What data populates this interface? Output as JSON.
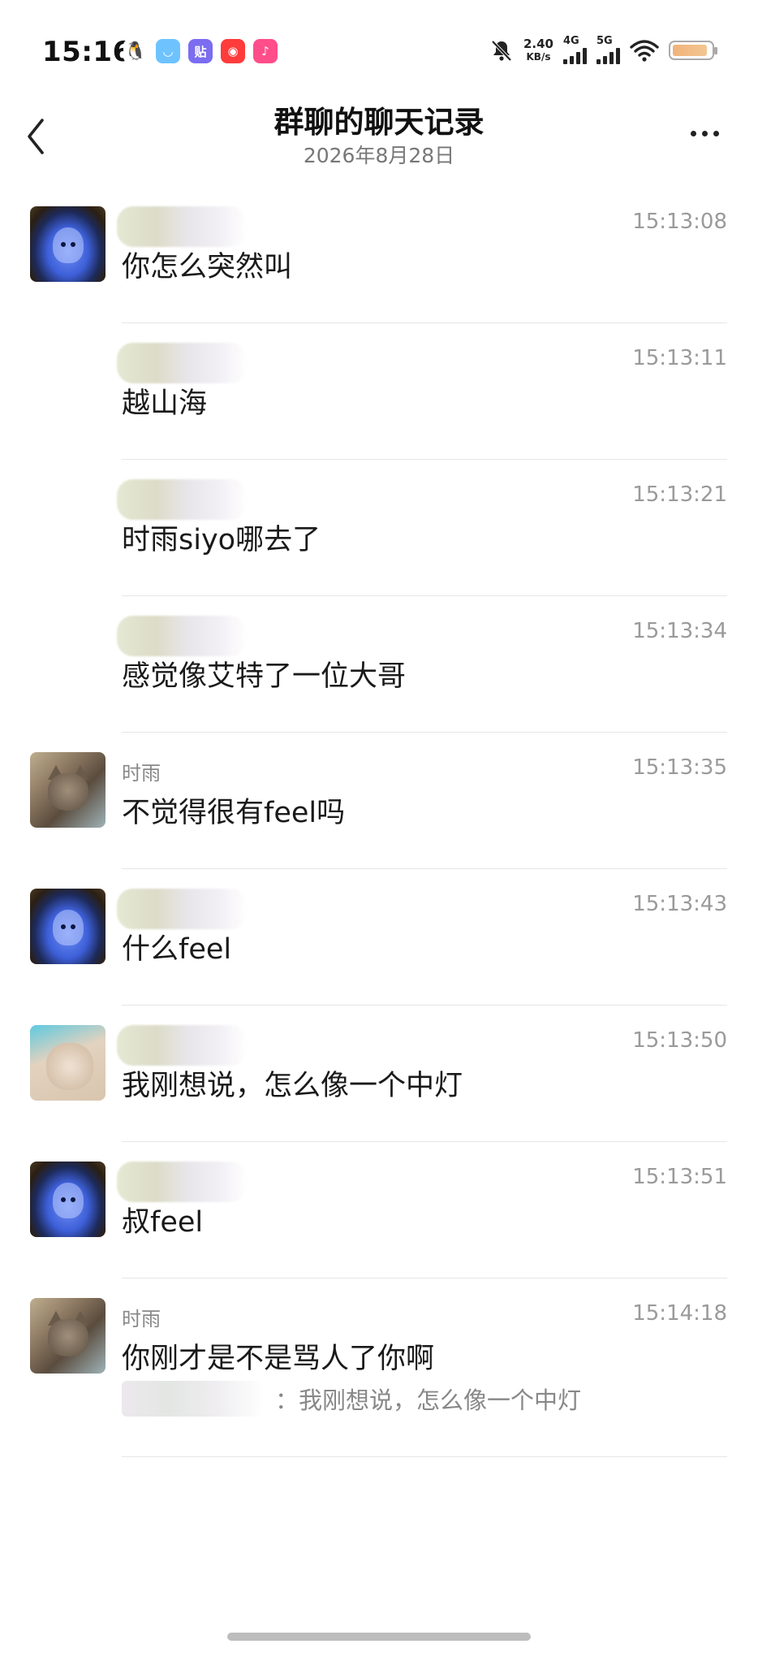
{
  "status_bar": {
    "time": "15:16",
    "app_icons": [
      "qq-icon",
      "chat-app-icon",
      "sticker-app-icon",
      "red-app-icon",
      "music-app-icon"
    ],
    "net_speed_value": "2.40",
    "net_speed_unit": "KB/s",
    "signal_1_label": "4G",
    "signal_2_label": "5G"
  },
  "header": {
    "title": "群聊的聊天记录",
    "subtitle": "2026年8月28日"
  },
  "messages": [
    {
      "sender": "",
      "time": "15:13:08",
      "text": "你怎么突然叫",
      "avatar": "ghost"
    },
    {
      "sender": "",
      "time": "15:13:11",
      "text": "越山海",
      "avatar": ""
    },
    {
      "sender": "",
      "time": "15:13:21",
      "text": "时雨siyo哪去了",
      "avatar": ""
    },
    {
      "sender": "",
      "time": "15:13:34",
      "text": "感觉像艾特了一位大哥",
      "avatar": ""
    },
    {
      "sender": "时雨",
      "time": "15:13:35",
      "text": "不觉得很有feel吗",
      "avatar": "cat"
    },
    {
      "sender": "",
      "time": "15:13:43",
      "text": "什么feel",
      "avatar": "ghost"
    },
    {
      "sender": "",
      "time": "15:13:50",
      "text": "我刚想说，怎么像一个中灯",
      "avatar": "cat2"
    },
    {
      "sender": "",
      "time": "15:13:51",
      "text": "叔feel",
      "avatar": "ghost"
    },
    {
      "sender": "时雨",
      "time": "15:14:18",
      "text": "你刚才是不是骂人了你啊",
      "avatar": "cat",
      "quote": "：我刚想说，怎么像一个中灯"
    }
  ]
}
